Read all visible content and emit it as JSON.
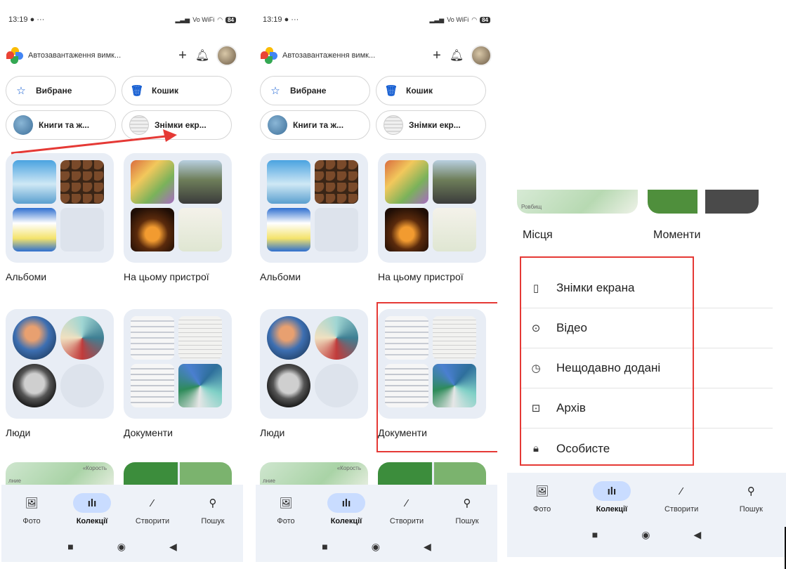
{
  "status": {
    "time": "13:19",
    "extra": "● ···",
    "network": "Vo WiFi",
    "battery": "84"
  },
  "app": {
    "title": "Автозавантаження вимк...",
    "add_icon": "+",
    "bell_icon": "⍀"
  },
  "chips": [
    {
      "label": "Вибране",
      "icon": "star-icon"
    },
    {
      "label": "Кошик",
      "icon": "trash-icon"
    },
    {
      "label": "Книги та ж...",
      "icon": "thumb"
    },
    {
      "label": "Знімки екр...",
      "icon": "thumb"
    }
  ],
  "collections": [
    {
      "label": "Альбоми"
    },
    {
      "label": "На цьому пристрої"
    },
    {
      "label": "Люди"
    },
    {
      "label": "Документи"
    }
  ],
  "peek": {
    "map_text1": "«Корость",
    "map_text2": "лние"
  },
  "nav": {
    "items": [
      {
        "label": "Фото",
        "icon": "photo-icon"
      },
      {
        "label": "Колекції",
        "icon": "collections-icon",
        "active": true
      },
      {
        "label": "Створити",
        "icon": "brush-icon"
      },
      {
        "label": "Пошук",
        "icon": "search-icon"
      }
    ],
    "system": {
      "recent": "■",
      "home": "◉",
      "back": "◀"
    }
  },
  "panel3": {
    "peek_labels": [
      "Місця",
      "Моменти"
    ],
    "map_text": "Ровбищ",
    "menu": [
      {
        "label": "Знімки екрана",
        "icon": "screenshot-icon"
      },
      {
        "label": "Відео",
        "icon": "video-icon"
      },
      {
        "label": "Нещодавно додані",
        "icon": "clock-icon"
      },
      {
        "label": "Архів",
        "icon": "archive-icon"
      },
      {
        "label": "Особисте",
        "icon": "lock-icon"
      }
    ]
  },
  "colors": {
    "highlight": "#e53935",
    "arrow": "#e53935",
    "nav_active": "#c9dcff",
    "tile_bg": "#e8edf5"
  }
}
